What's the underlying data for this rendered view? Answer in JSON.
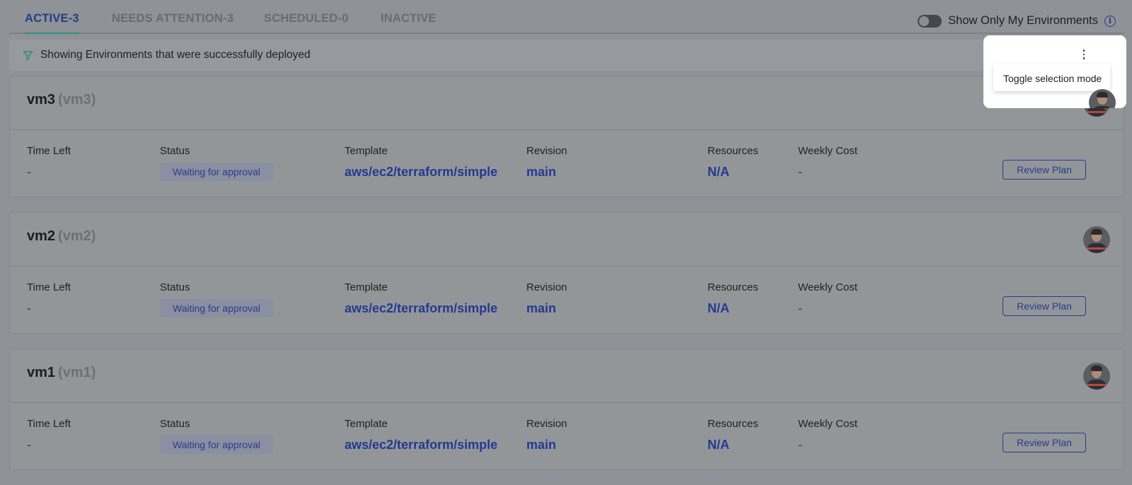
{
  "tabs": [
    {
      "label": "ACTIVE-3",
      "active": true
    },
    {
      "label": "NEEDS ATTENTION-3",
      "active": false
    },
    {
      "label": "SCHEDULED-0",
      "active": false
    },
    {
      "label": "INACTIVE",
      "active": false
    }
  ],
  "toggle": {
    "label": "Show Only My Environments",
    "on": false
  },
  "filter": {
    "text": "Showing Environments that were successfully deployed"
  },
  "menu": {
    "item": "Toggle selection mode"
  },
  "columns": {
    "time_left": "Time Left",
    "status": "Status",
    "template": "Template",
    "revision": "Revision",
    "resources": "Resources",
    "weekly_cost": "Weekly Cost"
  },
  "environments": [
    {
      "name": "vm3",
      "id": "(vm3)",
      "time_left": "-",
      "status": "Waiting for approval",
      "template": "aws/ec2/terraform/simple",
      "revision": "main",
      "resources": "N/A",
      "weekly_cost": "-",
      "action": "Review Plan"
    },
    {
      "name": "vm2",
      "id": "(vm2)",
      "time_left": "-",
      "status": "Waiting for approval",
      "template": "aws/ec2/terraform/simple",
      "revision": "main",
      "resources": "N/A",
      "weekly_cost": "-",
      "action": "Review Plan"
    },
    {
      "name": "vm1",
      "id": "(vm1)",
      "time_left": "-",
      "status": "Waiting for approval",
      "template": "aws/ec2/terraform/simple",
      "revision": "main",
      "resources": "N/A",
      "weekly_cost": "-",
      "action": "Review Plan"
    }
  ],
  "colors": {
    "accent": "#253c87",
    "tab_underline": "#2a8f85",
    "overlay_bg": "#8f9296"
  }
}
